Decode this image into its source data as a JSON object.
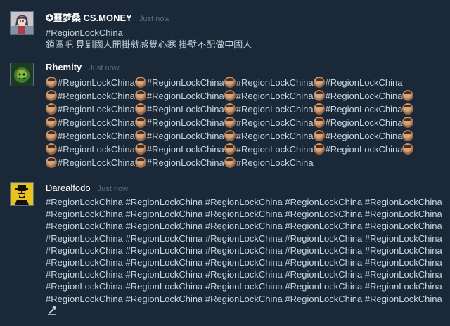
{
  "comments": [
    {
      "author": "✪噩梦桑 CS.MONEY",
      "timestamp": "Just now",
      "lines": [
        "#RegionLockChina",
        "鎖區吧 見到國人開掛就感覺心寒 掛壁不配做中國人"
      ]
    },
    {
      "author": "Rhemity",
      "timestamp": "Just now",
      "tag": "#RegionLockChina",
      "emote": "face-emoticon"
    },
    {
      "author": "Darealfodo",
      "timestamp": "Just now",
      "line_text": "#RegionLockChina #RegionLockChina #RegionLockChina #RegionLockChina #RegionLockChina"
    }
  ],
  "icons": {
    "avatar_1": "anime-girl-avatar",
    "avatar_2": "green-creature-avatar",
    "avatar_3": "heisenberg-avatar",
    "rhemity_emote": "face-emoticon",
    "trailing": "gavel-icon"
  },
  "colors": {
    "background": "#1b2838",
    "text": "#c6d4df",
    "author": "#ffffff",
    "timestamp": "#56707f"
  }
}
